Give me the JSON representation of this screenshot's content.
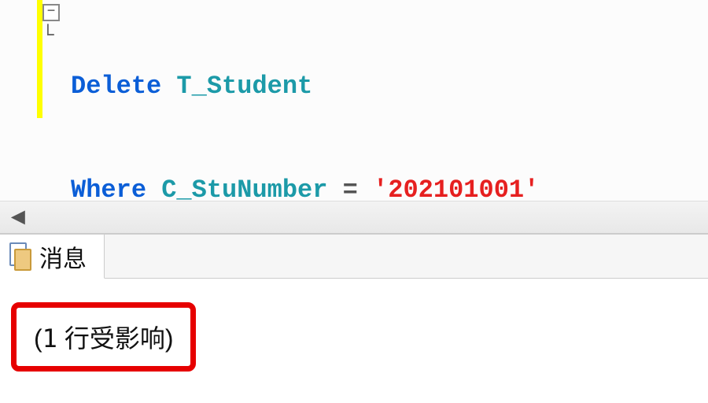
{
  "editor": {
    "fold_symbol": "−",
    "tree_marker": "└",
    "line1": {
      "keyword": "Delete",
      "table": "T_Student"
    },
    "line2": {
      "keyword": "Where",
      "column": "C_StuNumber",
      "operator": "=",
      "literal": "'202101001'"
    }
  },
  "scrollbar": {
    "arrow": "◄"
  },
  "results": {
    "tab_label": "消息",
    "message_open": "(",
    "message_count": "1",
    "message_text": " 行受影响",
    "message_close": ")"
  }
}
